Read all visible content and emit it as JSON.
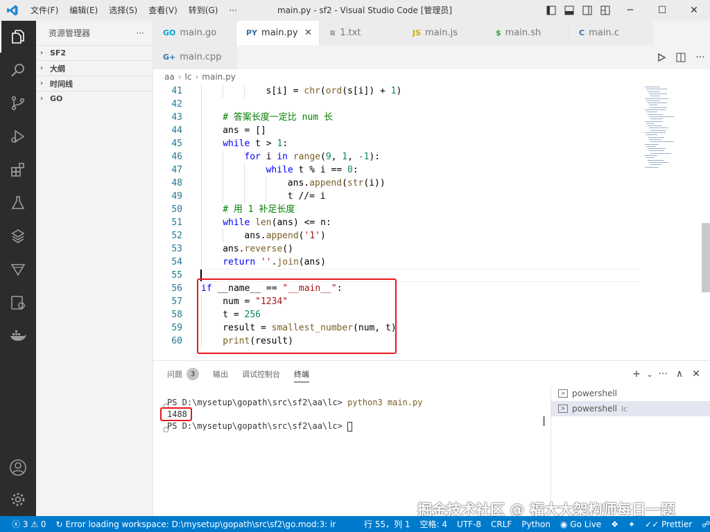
{
  "titlebar": {
    "menu": [
      "文件(F)",
      "编辑(E)",
      "选择(S)",
      "查看(V)",
      "转到(G)",
      "···"
    ],
    "title": "main.py - sf2 - Visual Studio Code [管理员]",
    "minimize": "─",
    "maximize": "☐",
    "close": "✕"
  },
  "sidebar": {
    "title": "资源管理器",
    "more": "···",
    "sections": [
      "SF2",
      "大纲",
      "时间线",
      "GO"
    ]
  },
  "tabs": [
    {
      "icon": "GO",
      "label": "main.go"
    },
    {
      "icon": "PY",
      "label": "main.py",
      "close": "✕"
    },
    {
      "icon": "≡",
      "label": "1.txt"
    },
    {
      "icon": "JS",
      "label": "main.js"
    },
    {
      "icon": "$",
      "label": "main.sh"
    },
    {
      "icon": "C",
      "label": "main.c"
    },
    {
      "icon": "G+",
      "label": "main.cpp"
    }
  ],
  "breadcrumb": [
    "aa",
    "lc",
    "main.py"
  ],
  "editor": {
    "lines": [
      {
        "n": "41",
        "indent": 12,
        "tokens": [
          [
            "s[i] = ",
            ""
          ],
          [
            "chr",
            "fn"
          ],
          [
            "(",
            ""
          ],
          [
            "ord",
            "fn"
          ],
          [
            "(s[i]) + ",
            ""
          ],
          [
            "1",
            "num"
          ],
          [
            ")",
            ""
          ]
        ]
      },
      {
        "n": "42",
        "indent": 0,
        "tokens": []
      },
      {
        "n": "43",
        "indent": 4,
        "tokens": [
          [
            "# 答案长度一定比 num 长",
            "cm"
          ]
        ]
      },
      {
        "n": "44",
        "indent": 4,
        "tokens": [
          [
            "ans = []",
            ""
          ]
        ]
      },
      {
        "n": "45",
        "indent": 4,
        "tokens": [
          [
            "while",
            "kw"
          ],
          [
            " t > ",
            ""
          ],
          [
            "1",
            "num"
          ],
          [
            ":",
            ""
          ]
        ]
      },
      {
        "n": "46",
        "indent": 8,
        "tokens": [
          [
            "for",
            "kw"
          ],
          [
            " i ",
            ""
          ],
          [
            "in",
            "kw"
          ],
          [
            " ",
            ""
          ],
          [
            "range",
            "fn"
          ],
          [
            "(",
            ""
          ],
          [
            "9",
            "num"
          ],
          [
            ", ",
            ""
          ],
          [
            "1",
            "num"
          ],
          [
            ", ",
            ""
          ],
          [
            "-1",
            "num"
          ],
          [
            "):",
            ""
          ]
        ]
      },
      {
        "n": "47",
        "indent": 12,
        "tokens": [
          [
            "while",
            "kw"
          ],
          [
            " t % i == ",
            ""
          ],
          [
            "0",
            "num"
          ],
          [
            ":",
            ""
          ]
        ]
      },
      {
        "n": "48",
        "indent": 16,
        "tokens": [
          [
            "ans.",
            ""
          ],
          [
            "append",
            "fn"
          ],
          [
            "(",
            ""
          ],
          [
            "str",
            "fn"
          ],
          [
            "(i))",
            ""
          ]
        ]
      },
      {
        "n": "49",
        "indent": 16,
        "tokens": [
          [
            "t //= i",
            ""
          ]
        ]
      },
      {
        "n": "50",
        "indent": 4,
        "tokens": [
          [
            "# 用 1 补足长度",
            "cm"
          ]
        ]
      },
      {
        "n": "51",
        "indent": 4,
        "tokens": [
          [
            "while",
            "kw"
          ],
          [
            " ",
            ""
          ],
          [
            "len",
            "fn"
          ],
          [
            "(ans) <= n:",
            ""
          ]
        ]
      },
      {
        "n": "52",
        "indent": 8,
        "tokens": [
          [
            "ans.",
            ""
          ],
          [
            "append",
            "fn"
          ],
          [
            "(",
            ""
          ],
          [
            "'1'",
            "str"
          ],
          [
            ")",
            ""
          ]
        ]
      },
      {
        "n": "53",
        "indent": 4,
        "tokens": [
          [
            "ans.",
            ""
          ],
          [
            "reverse",
            "fn"
          ],
          [
            "()",
            ""
          ]
        ]
      },
      {
        "n": "54",
        "indent": 4,
        "tokens": [
          [
            "return",
            "kw"
          ],
          [
            " ",
            ""
          ],
          [
            "''",
            "str"
          ],
          [
            ".",
            ""
          ],
          [
            "join",
            "fn"
          ],
          [
            "(ans)",
            ""
          ]
        ]
      },
      {
        "n": "55",
        "indent": 0,
        "tokens": []
      },
      {
        "n": "56",
        "indent": 0,
        "tokens": [
          [
            "if",
            "kw"
          ],
          [
            " __name__ == ",
            ""
          ],
          [
            "\"__main__\"",
            "str"
          ],
          [
            ":",
            ""
          ]
        ]
      },
      {
        "n": "57",
        "indent": 4,
        "tokens": [
          [
            "num = ",
            ""
          ],
          [
            "\"1234\"",
            "str"
          ]
        ]
      },
      {
        "n": "58",
        "indent": 4,
        "tokens": [
          [
            "t = ",
            ""
          ],
          [
            "256",
            "num"
          ]
        ]
      },
      {
        "n": "59",
        "indent": 4,
        "tokens": [
          [
            "result = ",
            ""
          ],
          [
            "smallest_number",
            "fn"
          ],
          [
            "(num, t)",
            ""
          ]
        ]
      },
      {
        "n": "60",
        "indent": 4,
        "tokens": [
          [
            "print",
            "fn"
          ],
          [
            "(result)",
            ""
          ]
        ]
      }
    ]
  },
  "panel": {
    "tabs": [
      "问题",
      "输出",
      "调试控制台",
      "终端"
    ],
    "problems_count": "3",
    "add": "+",
    "add_dropdown": "⌄",
    "more": "···",
    "maximize": "∧",
    "close": "✕",
    "terminal": {
      "prompt1": "PS D:\\mysetup\\gopath\\src\\sf2\\aa\\lc> ",
      "cmd1": "python3 main.py",
      "output": "1488",
      "prompt2": "PS D:\\mysetup\\gopath\\src\\sf2\\aa\\lc> "
    },
    "terminals": [
      {
        "label": "powershell",
        "sub": ""
      },
      {
        "label": "powershell",
        "sub": "lc"
      }
    ]
  },
  "statusbar": {
    "errors": "3",
    "warnings": "0",
    "workspace_error": "Error loading workspace: D:\\mysetup\\gopath\\src\\sf2\\go.mod:3: invalid g",
    "position": "行 55，列 1",
    "spaces": "空格: 4",
    "encoding": "UTF-8",
    "eol": "CRLF",
    "language": "Python",
    "golive": "Go Live",
    "prettier": "Prettier"
  },
  "watermark": "掘金技术社区 @ 福大大架构师每日一题"
}
